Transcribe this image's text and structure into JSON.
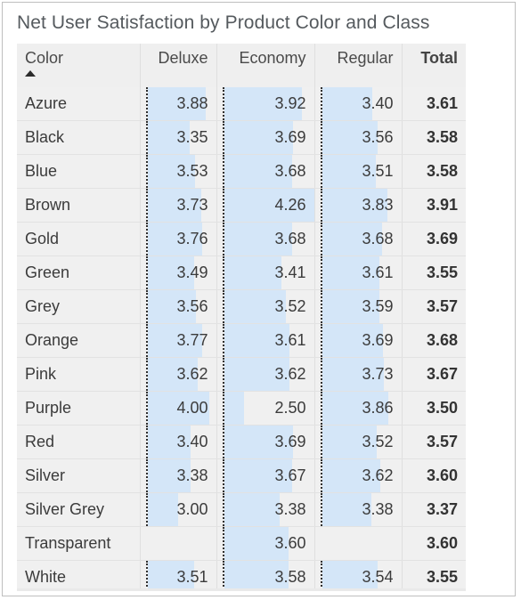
{
  "visual": {
    "title": "Net User Satisfaction by Product Color and Class",
    "sort_indicator": "sort-ascending-caret",
    "bar_color": "#d4e6f8",
    "axis_color": "#2f2f2f",
    "row_background": "#f0f0f0",
    "header_background": "#efefef"
  },
  "chart_data": {
    "type": "table",
    "title": "Net User Satisfaction by Product Color and Class",
    "columns": [
      "Color",
      "Deluxe",
      "Economy",
      "Regular",
      "Total"
    ],
    "row_key": "Color",
    "value_columns": [
      "Deluxe",
      "Economy",
      "Regular"
    ],
    "total_column": "Total",
    "sorted_by": "Color",
    "sort_direction": "ascending",
    "bar_scale": {
      "min": 2.0,
      "max": 4.26
    },
    "categories": [
      "Azure",
      "Black",
      "Blue",
      "Brown",
      "Gold",
      "Green",
      "Grey",
      "Orange",
      "Pink",
      "Purple",
      "Red",
      "Silver",
      "Silver Grey",
      "Transparent",
      "White"
    ],
    "series": [
      {
        "name": "Deluxe",
        "values": [
          3.88,
          3.35,
          3.53,
          3.73,
          3.76,
          3.49,
          3.56,
          3.77,
          3.62,
          4.0,
          3.4,
          3.38,
          3.0,
          null,
          3.51
        ]
      },
      {
        "name": "Economy",
        "values": [
          3.92,
          3.69,
          3.68,
          4.26,
          3.68,
          3.41,
          3.52,
          3.61,
          3.62,
          2.5,
          3.69,
          3.67,
          3.38,
          3.6,
          3.58
        ]
      },
      {
        "name": "Regular",
        "values": [
          3.4,
          3.56,
          3.51,
          3.83,
          3.68,
          3.61,
          3.59,
          3.69,
          3.73,
          3.86,
          3.52,
          3.62,
          3.38,
          null,
          3.54
        ]
      },
      {
        "name": "Total",
        "values": [
          3.61,
          3.58,
          3.58,
          3.91,
          3.69,
          3.55,
          3.57,
          3.68,
          3.67,
          3.5,
          3.57,
          3.6,
          3.37,
          3.6,
          3.55
        ]
      }
    ]
  },
  "rows": [
    {
      "color": "Azure",
      "deluxe": "3.88",
      "economy": "3.92",
      "regular": "3.40",
      "total": "3.61"
    },
    {
      "color": "Black",
      "deluxe": "3.35",
      "economy": "3.69",
      "regular": "3.56",
      "total": "3.58"
    },
    {
      "color": "Blue",
      "deluxe": "3.53",
      "economy": "3.68",
      "regular": "3.51",
      "total": "3.58"
    },
    {
      "color": "Brown",
      "deluxe": "3.73",
      "economy": "4.26",
      "regular": "3.83",
      "total": "3.91"
    },
    {
      "color": "Gold",
      "deluxe": "3.76",
      "economy": "3.68",
      "regular": "3.68",
      "total": "3.69"
    },
    {
      "color": "Green",
      "deluxe": "3.49",
      "economy": "3.41",
      "regular": "3.61",
      "total": "3.55"
    },
    {
      "color": "Grey",
      "deluxe": "3.56",
      "economy": "3.52",
      "regular": "3.59",
      "total": "3.57"
    },
    {
      "color": "Orange",
      "deluxe": "3.77",
      "economy": "3.61",
      "regular": "3.69",
      "total": "3.68"
    },
    {
      "color": "Pink",
      "deluxe": "3.62",
      "economy": "3.62",
      "regular": "3.73",
      "total": "3.67"
    },
    {
      "color": "Purple",
      "deluxe": "4.00",
      "economy": "2.50",
      "regular": "3.86",
      "total": "3.50"
    },
    {
      "color": "Red",
      "deluxe": "3.40",
      "economy": "3.69",
      "regular": "3.52",
      "total": "3.57"
    },
    {
      "color": "Silver",
      "deluxe": "3.38",
      "economy": "3.67",
      "regular": "3.62",
      "total": "3.60"
    },
    {
      "color": "Silver Grey",
      "deluxe": "3.00",
      "economy": "3.38",
      "regular": "3.38",
      "total": "3.37"
    },
    {
      "color": "Transparent",
      "deluxe": "",
      "economy": "3.60",
      "regular": "",
      "total": "3.60"
    },
    {
      "color": "White",
      "deluxe": "3.51",
      "economy": "3.58",
      "regular": "3.54",
      "total": "3.55"
    }
  ],
  "header": {
    "color": "Color",
    "deluxe": "Deluxe",
    "economy": "Economy",
    "regular": "Regular",
    "total": "Total"
  }
}
